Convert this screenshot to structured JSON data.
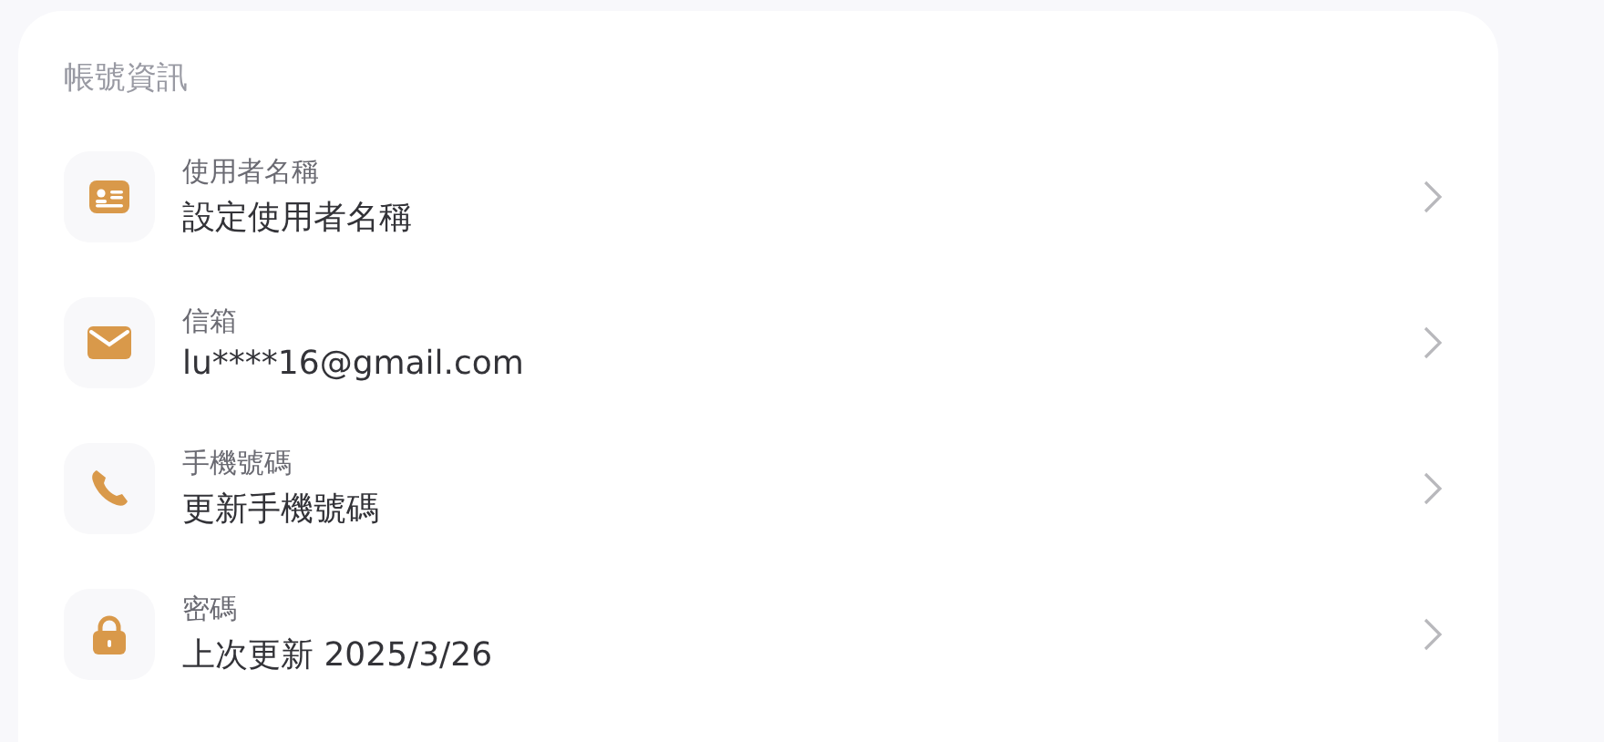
{
  "section": {
    "title": "帳號資訊"
  },
  "items": [
    {
      "kind": "id-card",
      "label": "使用者名稱",
      "value": "設定使用者名稱"
    },
    {
      "kind": "mail",
      "label": "信箱",
      "value": "lu****16@gmail.com"
    },
    {
      "kind": "phone",
      "label": "手機號碼",
      "value": "更新手機號碼"
    },
    {
      "kind": "lock",
      "label": "密碼",
      "value": "上次更新 2025/3/26"
    }
  ]
}
